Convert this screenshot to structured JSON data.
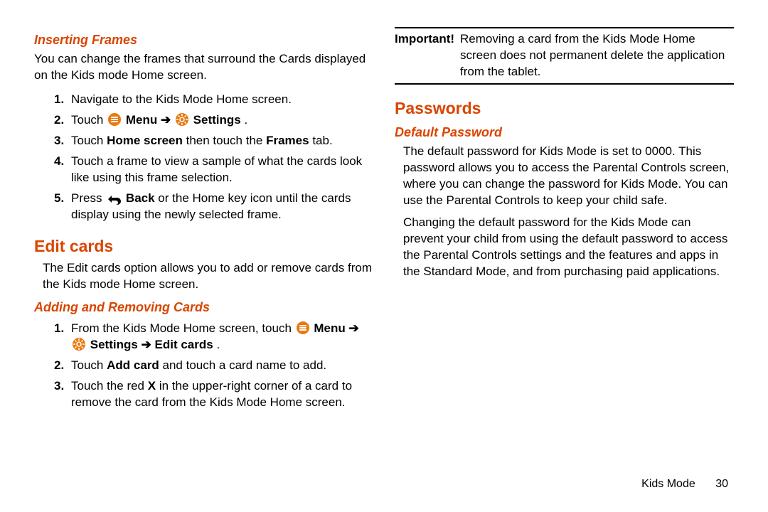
{
  "left": {
    "sub1_title": "Inserting Frames",
    "sub1_intro": "You can change the frames that surround the Cards displayed on the Kids mode Home screen.",
    "sub1_steps": [
      {
        "n": "1.",
        "text_a": "Navigate to the Kids Mode Home screen."
      },
      {
        "n": "2.",
        "text_a": "Touch ",
        "bold_a": "Menu",
        "arrow": " ➔ ",
        "bold_b": "Settings",
        "text_b": "."
      },
      {
        "n": "3.",
        "text_a": "Touch ",
        "bold_a": "Home screen",
        "text_b": " then touch the ",
        "bold_b": "Frames",
        "text_c": " tab."
      },
      {
        "n": "4.",
        "text_a": "Touch a frame to view a sample of what the cards look like using this frame selection."
      },
      {
        "n": "5.",
        "text_a": "Press ",
        "bold_a": "Back",
        "text_b": " or the Home key icon until the cards display using the newly selected frame."
      }
    ],
    "h2_title": "Edit cards",
    "h2_intro": "The Edit cards option allows you to add or remove cards from the Kids mode Home screen.",
    "sub2_title": "Adding and Removing Cards",
    "sub2_steps": [
      {
        "n": "1.",
        "text_a": "From the Kids Mode Home screen, touch ",
        "bold_a": "Menu",
        "arrow_a": " ➔ ",
        "bold_b": "Settings",
        "arrow_b": " ➔ ",
        "bold_c": "Edit cards",
        "text_b": "."
      },
      {
        "n": "2.",
        "text_a": "Touch ",
        "bold_a": "Add card",
        "text_b": " and touch a card name to add."
      },
      {
        "n": "3.",
        "text_a": "Touch the red ",
        "bold_a": "X",
        "text_b": " in the upper-right corner of a card to remove the card from the Kids Mode Home screen."
      }
    ]
  },
  "right": {
    "important_label": "Important!",
    "important_text": "Removing a card from the Kids Mode Home screen does not permanent delete the application from the tablet.",
    "h1_title": "Passwords",
    "sub1_title": "Default Password",
    "p1": "The default password for Kids Mode is set to 0000. This password allows you to access the Parental Controls screen, where you can change the password for Kids Mode. You can use the Parental Controls to keep your child safe.",
    "p2": "Changing the default password for the Kids Mode can prevent your child from using the default password to access the Parental Controls settings and the features and apps in the Standard Mode, and from purchasing paid applications."
  },
  "footer": {
    "chapter": "Kids Mode",
    "page": "30"
  }
}
